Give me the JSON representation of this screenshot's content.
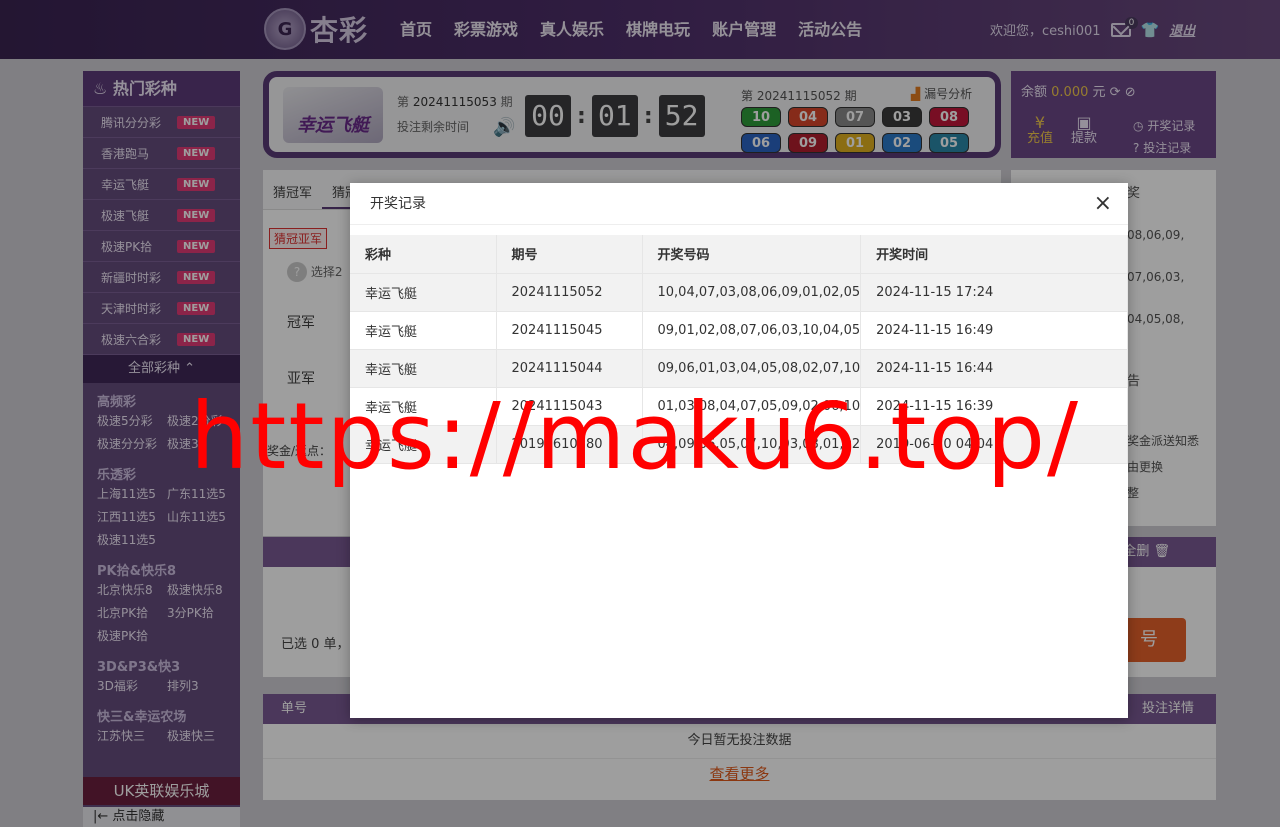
{
  "header": {
    "logo_mark": "G",
    "logo_text": "杏彩",
    "nav": [
      "首页",
      "彩票游戏",
      "真人娱乐",
      "棋牌电玩",
      "账户管理",
      "活动公告"
    ],
    "welcome": "欢迎您，ceshi001",
    "mail_count": "0",
    "logout": "退出"
  },
  "sidebar": {
    "title": "热门彩种",
    "hot": [
      {
        "label": "腾讯分分彩",
        "badge": "NEW"
      },
      {
        "label": "香港跑马",
        "badge": "NEW"
      },
      {
        "label": "幸运飞艇",
        "badge": "NEW"
      },
      {
        "label": "极速飞艇",
        "badge": "NEW"
      },
      {
        "label": "极速PK拾",
        "badge": "NEW"
      },
      {
        "label": "新疆时时彩",
        "badge": "NEW"
      },
      {
        "label": "天津时时彩",
        "badge": "NEW"
      },
      {
        "label": "极速六合彩",
        "badge": "NEW"
      }
    ],
    "all_kinds": "全部彩种 ⌃",
    "cats": [
      {
        "title": "高频彩",
        "items": [
          "极速5分彩",
          "极速2分彩",
          "极速分分彩",
          "极速3"
        ]
      },
      {
        "title": "乐透彩",
        "items": [
          "上海11选5",
          "广东11选5",
          "江西11选5",
          "山东11选5",
          "极速11选5"
        ]
      },
      {
        "title": "PK拾&快乐8",
        "items": [
          "北京快乐8",
          "极速快乐8",
          "北京PK拾",
          "3分PK拾",
          "极速PK拾"
        ]
      },
      {
        "title": "3D&P3&快3",
        "items": [
          "3D福彩",
          "排列3"
        ]
      },
      {
        "title": "快三&幸运农场",
        "items": [
          "江苏快三",
          "极速快三"
        ]
      }
    ],
    "uk": "UK英联娱乐城",
    "hide": "|← 点击隐藏"
  },
  "game": {
    "name": "幸运飞艇",
    "issue_prefix": "第",
    "issue": "20241115053",
    "issue_suffix": "期",
    "remain": "投注剩余时间",
    "timer": [
      "00",
      "01",
      "52"
    ],
    "last_issue": "第 20241115052 期",
    "trend": "漏号分析",
    "balls": [
      {
        "n": "10",
        "c": "#2e9d3a"
      },
      {
        "n": "04",
        "c": "#d8462a"
      },
      {
        "n": "07",
        "c": "#8a8a8a"
      },
      {
        "n": "03",
        "c": "#3a3a3a"
      },
      {
        "n": "08",
        "c": "#c2183a"
      },
      {
        "n": "06",
        "c": "#2a64c4"
      },
      {
        "n": "09",
        "c": "#b21e2e"
      },
      {
        "n": "01",
        "c": "#e0b020"
      },
      {
        "n": "02",
        "c": "#2a7ac8"
      },
      {
        "n": "05",
        "c": "#2a88a8"
      }
    ]
  },
  "account": {
    "balance_label": "余额",
    "balance": "0.000",
    "unit": "元",
    "recharge": "充值",
    "withdraw": "提款",
    "draw_record": "开奖记录",
    "bet_record": "投注记录"
  },
  "tabs": [
    "猜冠军",
    "猜冠"
  ],
  "sub": {
    "tag": "猜冠亚军",
    "hint": "选择2",
    "champion": "冠军",
    "runner": "亚军",
    "odds": "奖金/返点："
  },
  "right_panel": {
    "title": "奖",
    "lines": [
      "08,06,09,",
      "07,06,03,",
      "04,05,08,"
    ],
    "title2": "告",
    "notices": [
      "奖金派送知悉",
      "由更换",
      "整"
    ]
  },
  "order": {
    "selected": "已选 0 单，",
    "clear": "全删",
    "submit": "号"
  },
  "bottom": {
    "col_no": "单号",
    "col_detail": "投注详情",
    "empty": "今日暂无投注数据",
    "more": "查看更多"
  },
  "modal": {
    "title": "开奖记录",
    "headers": [
      "彩种",
      "期号",
      "开奖号码",
      "开奖时间"
    ],
    "rows": [
      [
        "幸运飞艇",
        "20241115052",
        "10,04,07,03,08,06,09,01,02,05",
        "2024-11-15 17:24"
      ],
      [
        "幸运飞艇",
        "20241115045",
        "09,01,02,08,07,06,03,10,04,05",
        "2024-11-15 16:49"
      ],
      [
        "幸运飞艇",
        "20241115044",
        "09,06,01,03,04,05,08,02,07,10",
        "2024-11-15 16:44"
      ],
      [
        "幸运飞艇",
        "20241115043",
        "01,03,08,04,07,05,09,02,06,10",
        "2024-11-15 16:39"
      ],
      [
        "幸运飞艇",
        "20190610180",
        "04,09,06,05,07,10,03,08,01,02",
        "2019-06-10 04:04"
      ]
    ]
  },
  "watermark": "https://maku6.top/"
}
